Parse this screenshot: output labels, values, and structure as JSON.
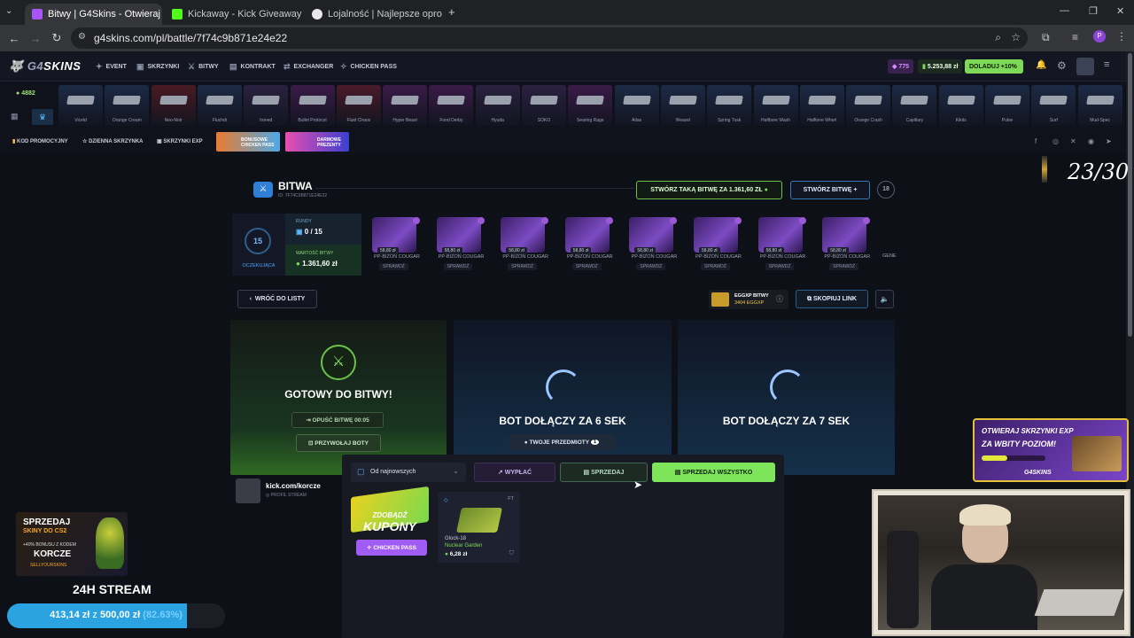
{
  "browser": {
    "tabs": [
      {
        "title": "Bitwy | G4Skins - Otwieraj skrzy...",
        "active": true,
        "color": "#a855f7"
      },
      {
        "title": "Kickaway - Kick Giveaway Tool",
        "active": false,
        "color": "#53fc18"
      },
      {
        "title": "Lojalność | Najlepsze oprogram...",
        "active": false,
        "color": "#e8e8e8"
      }
    ],
    "url": "g4skins.com/pl/battle/7f74c9b871e24e22"
  },
  "header": {
    "logo_left": "G4",
    "logo_right": "SKINS",
    "nav": [
      "EVENT",
      "SKRZYNKI",
      "BITWY",
      "KONTRAKT",
      "EXCHANGER",
      "CHICKEN PASS"
    ],
    "level": "775",
    "balance": "5.253,88 zł",
    "deposit": "DOLADUJ +10%"
  },
  "strip": {
    "counter": "4882",
    "items": [
      {
        "name": "Viceld",
        "color": "#1c2a45"
      },
      {
        "name": "Orange Cream",
        "color": "#1c2a45"
      },
      {
        "name": "Neo-Noir",
        "color": "#4a1a22"
      },
      {
        "name": "Fluchdi",
        "color": "#1c2a45"
      },
      {
        "name": "Ironed",
        "color": "#2a2140"
      },
      {
        "name": "Bullet Protocol",
        "color": "#3b1a48"
      },
      {
        "name": "Fluid Chaos",
        "color": "#4a1a2a"
      },
      {
        "name": "Hyper Beast",
        "color": "#3b1a48"
      },
      {
        "name": "Food Derby",
        "color": "#3b1a48"
      },
      {
        "name": "Hyuda",
        "color": "#2a2140"
      },
      {
        "name": "SOKO",
        "color": "#2a2140"
      },
      {
        "name": "Searing Rage",
        "color": "#3b1a48"
      },
      {
        "name": "Atlas",
        "color": "#1c2a45"
      },
      {
        "name": "Weasel",
        "color": "#1c2a45"
      },
      {
        "name": "Spring Tusk",
        "color": "#1c2a45"
      },
      {
        "name": "Halfbore Wash",
        "color": "#1c2a45"
      },
      {
        "name": "Halftone Whorl",
        "color": "#1c2a45"
      },
      {
        "name": "Orange Crash",
        "color": "#1c2a45"
      },
      {
        "name": "Capillary",
        "color": "#1c2a45"
      },
      {
        "name": "Kikits",
        "color": "#1c2a45"
      },
      {
        "name": "Pulse",
        "color": "#1c2a45"
      },
      {
        "name": "Surf",
        "color": "#1c2a45"
      },
      {
        "name": "Mud-Spec",
        "color": "#1c2a45"
      }
    ]
  },
  "promo": {
    "items": [
      "KOD PROMOCYJNY",
      "DZIENNA SKRZYNKA",
      "SKRZYNKI EXP"
    ],
    "banner1": "BONUSOWE CHICKEN PASS",
    "banner2": "DARMOWE PREZENTY"
  },
  "battle": {
    "title": "BITWA",
    "id": "ID: 7F74C9B871E24E22",
    "create_same": "STWÓRZ TAKĄ BITWĘ ZA 1.361,60 ZŁ",
    "create": "STWÓRZ BITWĘ",
    "age": "18",
    "round_badge": "15",
    "status": "OCZEKUJĄCA",
    "rounds_label": "RUNDY",
    "rounds_value": "0 / 15",
    "value_label": "WARTOŚĆ BITWY",
    "value": "1.361,60 zł",
    "case_name": "PP-BIZON COUGAR",
    "case_price": "58,80 zł",
    "case_check": "SPRAWDŹ",
    "case_partial": "GENE",
    "back": "WRÓĆ DO LISTY",
    "xp_label": "EGGXP BITWY",
    "xp_value": "3404 EGGXP",
    "copy_link": "SKOPIUJ LINK"
  },
  "players": {
    "ready": "GOTOWY DO BITWY!",
    "leave": "OPUŚĆ BITWĘ 00:05",
    "call_bots": "PRZYWOŁAJ BOTY",
    "bot1": "BOT DOŁĄCZY ZA 6 SEK",
    "bot2": "BOT DOŁĄCZY ZA 7 SEK",
    "my_items": "TWOJE PRZEDMIOTY",
    "my_items_count": "1",
    "user_name": "kick.com/korcze",
    "user_sub": "PROFIL STREAM"
  },
  "inventory": {
    "sort": "Od najnowszych",
    "withdraw": "WYPŁAĆ",
    "sell": "SPRZEDAJ",
    "sell_all": "SPRZEDAJ WSZYSTKO",
    "promo_line1": "ZDOBĄDŹ",
    "promo_line2": "KUPONY",
    "promo_btn": "CHICKEN PASS",
    "item_wear": "FT",
    "item_name": "Glock-18",
    "item_skin": "Nuclear Garden",
    "item_price": "6,28 zł"
  },
  "overlay": {
    "counter": "23/30",
    "sell_line1": "SPRZEDAJ",
    "sell_line2": "SKINY DO CS2",
    "sell_line3": "+40% BONUSU Z KODEM",
    "sell_line4": "KORCZE",
    "sell_brand": "SELLYOURSKINS",
    "stream": "24H STREAM",
    "goal_current": "413,14 zł",
    "goal_sep": "z",
    "goal_target": "500,00 zł",
    "goal_pct": "(82.63%)",
    "goal_progress": 0.8263,
    "exp_line1": "OTWIERAJ SKRZYNKI EXP",
    "exp_line2": "ZA WBITY POZIOM!",
    "exp_brand": "G4SKINS"
  },
  "colors": {
    "accent_green": "#7ed957",
    "accent_purple": "#a05cf5",
    "panel_blue": "#17324a"
  }
}
